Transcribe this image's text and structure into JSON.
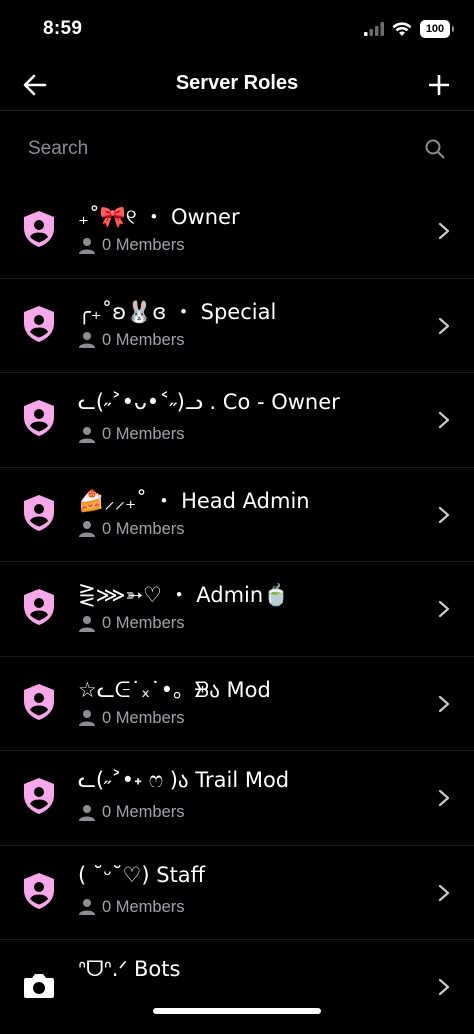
{
  "status_bar": {
    "time": "8:59",
    "battery": "100"
  },
  "header": {
    "title": "Server Roles"
  },
  "search": {
    "placeholder": "Search",
    "value": ""
  },
  "colors": {
    "role_icon": "#f7a8e8",
    "bot_icon": "#ffffff",
    "muted_text": "#a0a2a8",
    "background": "#000000"
  },
  "roles": [
    {
      "name": "₊˚🎀୧ ・ Owner",
      "members": "0 Members",
      "icon": "shield-user-icon"
    },
    {
      "name": "╭₊˚ʚ🐰ɞ ・ Special",
      "members": "0 Members",
      "icon": "shield-user-icon"
    },
    {
      "name": "ᓚ(˶˃•ᴗ•˂˶)ᓗ . Co - Owner",
      "members": "0 Members",
      "icon": "shield-user-icon"
    },
    {
      "name": "🍰⸝⸝₊˚ ・ Head Admin",
      "members": "0 Members",
      "icon": "shield-user-icon"
    },
    {
      "name": "⋛⋙➳♡ ・ Admin🍵",
      "members": "0 Members",
      "icon": "shield-user-icon"
    },
    {
      "name": "☆ᓚᕮ˙ₓ˙•。ᗾა Mod",
      "members": "0 Members",
      "icon": "shield-user-icon"
    },
    {
      "name": "ᓚ(˶˃•˖ ෆ )ა Trail Mod",
      "members": "0 Members",
      "icon": "shield-user-icon"
    },
    {
      "name": "( ˘ᵕ˘♡) Staff",
      "members": "0 Members",
      "icon": "shield-user-icon"
    },
    {
      "name": "ᐢᗜᐢ.ᐟ Bots",
      "members": "",
      "icon": "robot-icon"
    }
  ]
}
